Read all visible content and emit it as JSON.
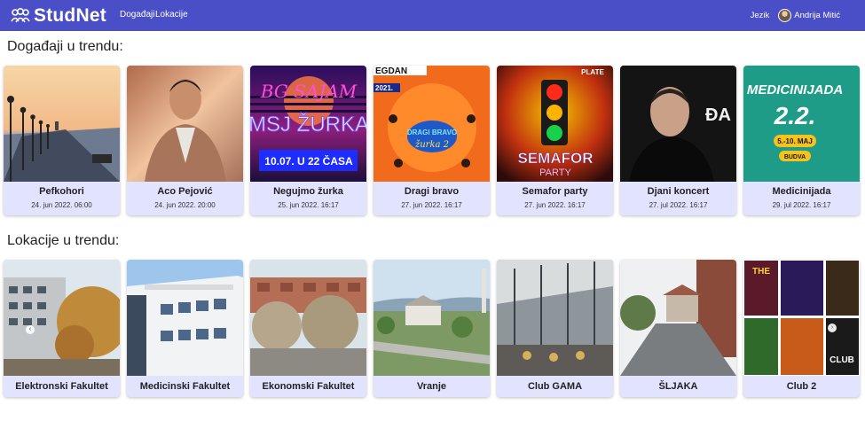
{
  "nav": {
    "brand": "StudNet",
    "links": [
      "Događaji",
      "Lokacije"
    ],
    "language": "Jezik",
    "user": "Andrija Mitić"
  },
  "sections": {
    "events_title": "Događaji u trendu:",
    "locations_title": "Lokacije u trendu:"
  },
  "events": [
    {
      "title": "Pefkohori",
      "date": "24. jun 2022. 06:00",
      "image": "sea-pier-sunset"
    },
    {
      "title": "Aco Pejović",
      "date": "24. jun 2022. 20:00",
      "image": "singer-portrait"
    },
    {
      "title": "Negujmo žurka",
      "date": "25. jun 2022. 16:17",
      "image": "neon-party-poster",
      "poster_lines": [
        "BG SAJAM",
        "MSJ ŽURKA",
        "10.07. U 22 ČASA"
      ]
    },
    {
      "title": "Dragi bravo",
      "date": "27. jun 2022. 16:17",
      "image": "orange-party-poster",
      "poster_lines": [
        "EGDAN",
        "2021.",
        "DRAGI BRAVO",
        "žurka 2"
      ]
    },
    {
      "title": "Semafor party",
      "date": "27. jun 2022. 16:17",
      "image": "traffic-light-poster",
      "poster_lines": [
        "PLATE",
        "SEMAFOR",
        "PARTY"
      ]
    },
    {
      "title": "Djani koncert",
      "date": "27. jul 2022. 16:17",
      "image": "singer-dark-portrait",
      "poster_lines": [
        "ĐA"
      ]
    },
    {
      "title": "Medicinijada",
      "date": "29. jul 2022. 16:17",
      "image": "medicinijada-poster",
      "poster_lines": [
        "MEDICINIJADA",
        "2.2.",
        "5.-10. MAJ",
        "BUDVA"
      ]
    }
  ],
  "locations": [
    {
      "title": "Elektronski Fakultet",
      "image": "faculty-building-autumn"
    },
    {
      "title": "Medicinski Fakultet",
      "image": "white-faculty-building"
    },
    {
      "title": "Ekonomski Fakultet",
      "image": "city-street-trees"
    },
    {
      "title": "Vranje",
      "image": "town-aerial-view"
    },
    {
      "title": "Club GAMA",
      "image": "club-terrace"
    },
    {
      "title": "ŠLJAKA",
      "image": "rainy-street"
    },
    {
      "title": "Club 2",
      "image": "club-poster-collage",
      "poster_lines": [
        "THE",
        "CLUB"
      ]
    }
  ],
  "colors": {
    "navbar": "#4a4fc7",
    "card_body": "#e2e3ff"
  }
}
